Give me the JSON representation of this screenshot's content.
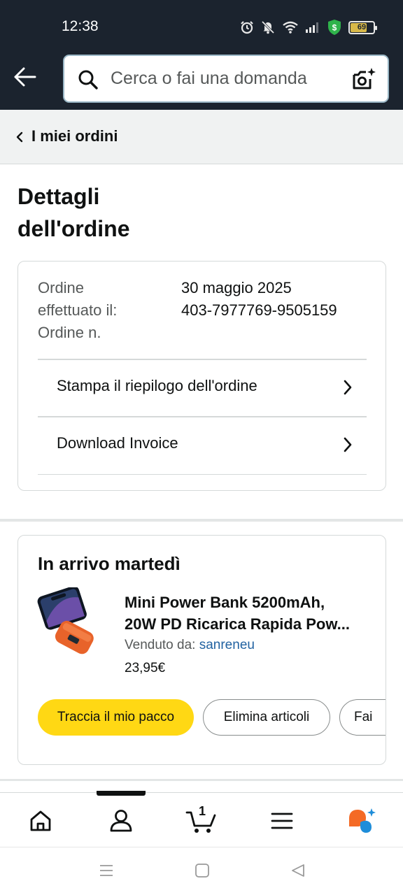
{
  "status_bar": {
    "time": "12:38",
    "battery_level": "69",
    "icons": [
      "alarm-icon",
      "mute-icon",
      "wifi-icon",
      "signal-icon",
      "shield-dollar-icon",
      "battery-icon"
    ]
  },
  "header": {
    "back_icon": "back-arrow-icon",
    "search_placeholder": "Cerca o fai una domanda",
    "camera_icon": "camera-search-icon"
  },
  "breadcrumb": {
    "label": "I miei ordini"
  },
  "page": {
    "title_line1": "Dettagli",
    "title_line2": "dell'ordine"
  },
  "order_summary": {
    "placed_label_line1": "Ordine",
    "placed_label_line2": "effettuato il:",
    "placed_value": "30 maggio 2025",
    "number_label": "Ordine n.",
    "number_value": "403-7977769-9505159",
    "links": [
      {
        "label": "Stampa il riepilogo dell'ordine"
      },
      {
        "label": "Download Invoice"
      }
    ]
  },
  "shipment": {
    "status": "In arrivo martedì",
    "product": {
      "name_line1": "Mini Power Bank 5200mAh,",
      "name_line2": "20W PD Ricarica Rapida Pow...",
      "seller_label": "Venduto da:",
      "seller_name": "sanreneu",
      "price": "23,95€",
      "image": "orange-power-bank-with-phone"
    },
    "buttons": {
      "track": "Traccia il mio pacco",
      "delete": "Elimina articoli",
      "more": "Fai"
    }
  },
  "bottom_nav": {
    "cart_count": "1",
    "items": [
      "home-icon",
      "account-icon",
      "cart-icon",
      "menu-icon",
      "rufus-assistant-icon"
    ],
    "active": "account-icon"
  },
  "system_nav": {
    "items": [
      "recents-icon",
      "home-square-icon",
      "back-triangle-icon"
    ]
  },
  "colors": {
    "header_bg": "#1b232e",
    "accent_yellow": "#ffd814",
    "link_blue": "#2162a1",
    "breadcrumb_bg": "#f0f2f2"
  }
}
